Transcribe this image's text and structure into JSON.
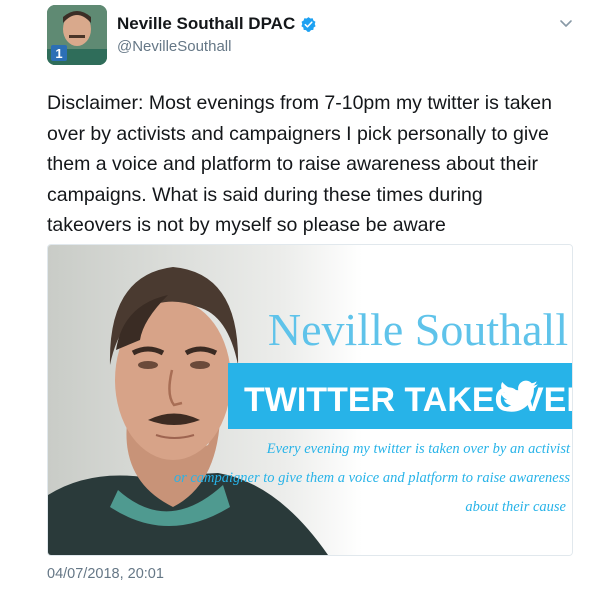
{
  "author": {
    "display_name": "Neville Southall DPAC",
    "handle": "@NevilleSouthall",
    "verified": true,
    "verified_icon": "verified-badge-icon",
    "menu_icon": "chevron-down-icon",
    "avatar_badge": "1"
  },
  "tweet": {
    "text": "Disclaimer: Most evenings from 7-10pm my twitter is taken over by activists and campaigners I pick personally to give them a voice and platform to raise awareness about their campaigns. What is said during these times during takeovers is not by myself so please be aware",
    "timestamp": "04/07/2018, 20:01"
  },
  "media": {
    "title": "Neville Southall",
    "banner": "TWITTER TAKEOVER",
    "banner_icon": "twitter-bird-icon",
    "caption_line1": "Every evening my twitter is taken over by an activist",
    "caption_line2": "or campaigner to give them a voice and platform to raise awareness",
    "caption_line3": "about their cause"
  },
  "colors": {
    "accent_blue": "#1da1f2",
    "banner_blue": "#27b3e8",
    "title_blue": "#5fc3ea",
    "text_primary": "#14171a",
    "text_secondary": "#657786"
  }
}
